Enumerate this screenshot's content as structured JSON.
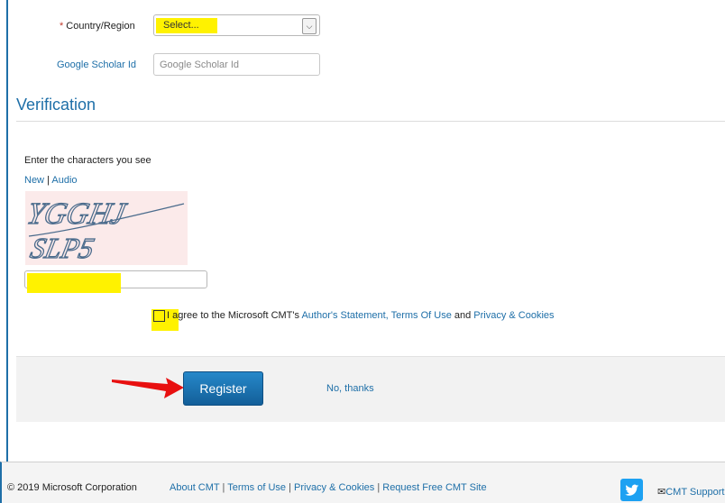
{
  "form": {
    "country_label": "Country/Region",
    "country_required_mark": "*",
    "country_selected": "Select...",
    "scholar_label": "Google Scholar Id",
    "scholar_placeholder": "Google Scholar Id"
  },
  "verification": {
    "title": "Verification",
    "prompt": "Enter the characters you see",
    "new_link": "New",
    "separator": "|",
    "audio_link": "Audio",
    "captcha_line1": "YGGHJ",
    "captcha_line2": "SLP5"
  },
  "agreement": {
    "prefix_first": "I",
    "prefix_rest": "agree to the Microsoft CMT's",
    "authors_statement": "Author's Statement,",
    "terms": "Terms Of Use",
    "and": "and",
    "privacy": "Privacy & Cookies"
  },
  "actions": {
    "register": "Register",
    "no_thanks": "No, thanks"
  },
  "footer": {
    "copyright": "© 2019 Microsoft Corporation",
    "about": "About CMT",
    "terms": "Terms of Use",
    "privacy": "Privacy & Cookies",
    "request": "Request Free CMT Site",
    "sep": "|",
    "support": "CMT Support"
  },
  "colors": {
    "accent": "#1e6fa8",
    "highlight": "#fff200",
    "arrow": "#e81010"
  }
}
